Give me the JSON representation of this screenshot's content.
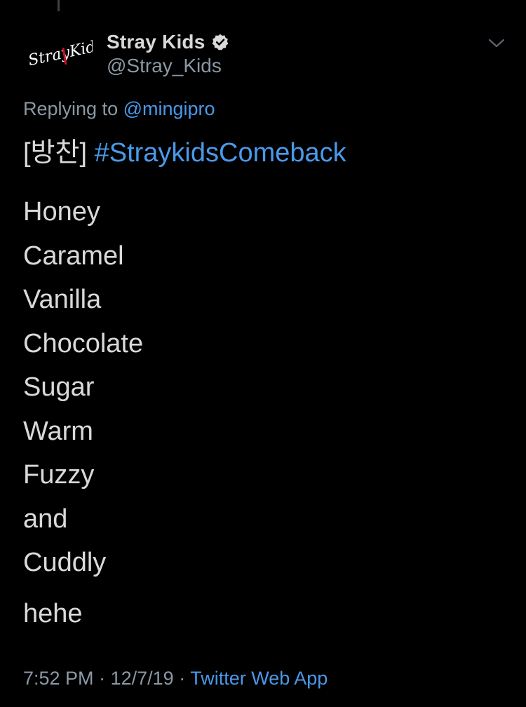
{
  "tweet": {
    "display_name": "Stray Kids",
    "handle": "@Stray_Kids",
    "avatar_text": "StrayKids",
    "replying_prefix": "Replying to",
    "replying_to": "@mingipro",
    "first_line_prefix": "[방찬]",
    "hashtag": "#StraykidsComeback",
    "lines": [
      "Honey",
      "Caramel",
      "Vanilla",
      "Chocolate",
      "Sugar",
      "Warm",
      "Fuzzy",
      "and",
      "Cuddly"
    ],
    "last_line": "hehe",
    "time": "7:52 PM",
    "separator": "·",
    "date": "12/7/19",
    "source": "Twitter Web App"
  },
  "icons": {
    "verified": "verified-badge-icon",
    "chevron": "chevron-down-icon"
  },
  "colors": {
    "background": "#000000",
    "text": "#d9d9d9",
    "muted": "#8b98a5",
    "accent": "#4a99e9",
    "logo_red": "#c8102e"
  }
}
